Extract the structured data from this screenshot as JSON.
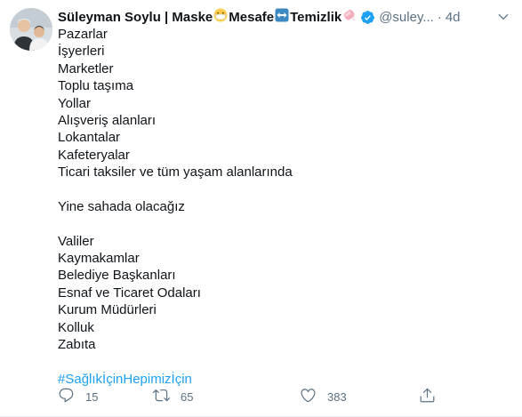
{
  "tweet": {
    "display_name_parts": [
      "Süleyman Soylu | Maske",
      " Mesafe",
      " Temizlik"
    ],
    "handle": "@suley...",
    "separator": "·",
    "time": "4d",
    "lines": [
      "Pazarlar",
      "İşyerleri",
      "Marketler",
      "Toplu taşıma",
      "Yollar",
      "Alışveriş alanları",
      "Lokantalar",
      "Kafeteryalar",
      "Ticari taksiler ve tüm yaşam alanlarında",
      "",
      "Yine sahada olacağız",
      "",
      "Valiler",
      "Kaymakamlar",
      "Belediye Başkanları",
      "Esnaf ve Ticaret Odaları",
      "Kurum Müdürleri",
      "Kolluk",
      "Zabıta",
      ""
    ],
    "hashtag": "#SağlıkİçinHepimizİçin",
    "actions": {
      "reply_count": "15",
      "retweet_count": "65",
      "like_count": "383"
    }
  },
  "icons": {
    "emoji_1": "face-with-medical-mask-emoji",
    "emoji_2": "left-right-arrow-emoji",
    "emoji_3": "soap-emoji",
    "verified": "verified-badge-icon",
    "more": "chevron-down-icon",
    "reply": "reply-icon",
    "retweet": "retweet-icon",
    "like": "heart-icon",
    "share": "share-icon"
  },
  "colors": {
    "text": "#0f1419",
    "secondary": "#5b7083",
    "link": "#1da1f2",
    "verified": "#1da1f2",
    "divider": "#ebeef0"
  }
}
